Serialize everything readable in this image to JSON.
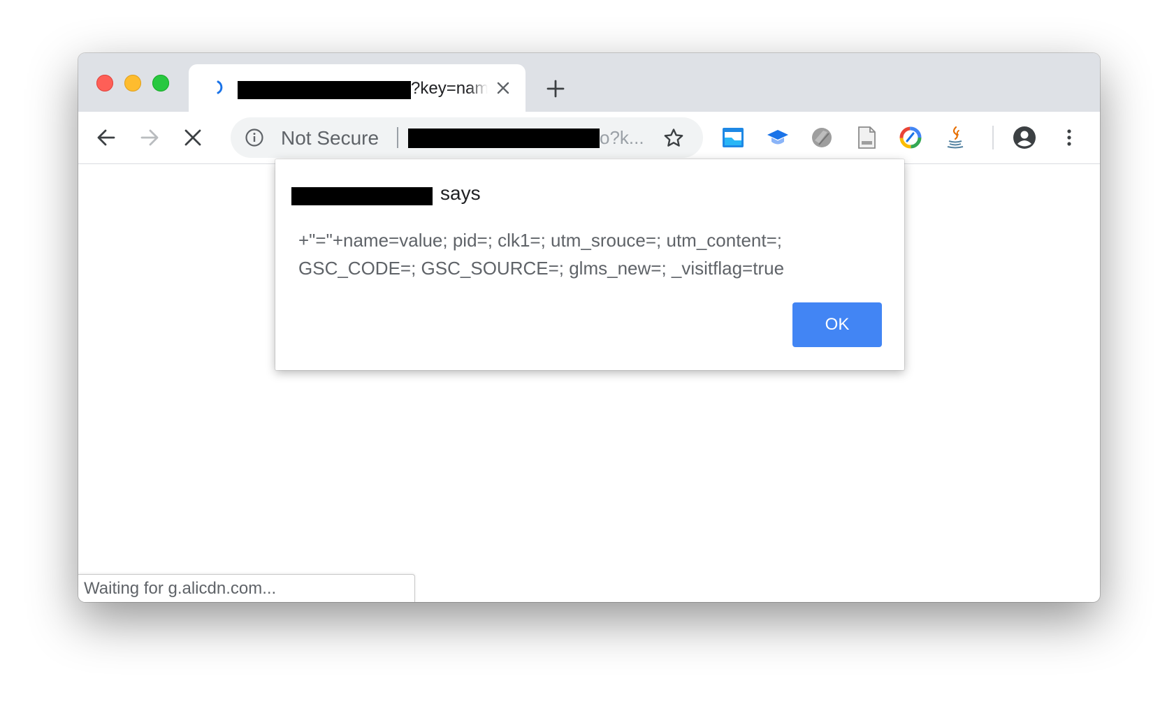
{
  "tab": {
    "title": "?key=name",
    "close_icon": "close-icon",
    "loading_icon": "tab-loading-spinner-icon"
  },
  "toolbar": {
    "back_icon": "arrow-left-icon",
    "forward_icon": "arrow-right-icon",
    "stop_icon": "close-icon",
    "new_tab_icon": "plus-icon"
  },
  "omnibox": {
    "security_label": "Not Secure",
    "url_tail": "o?k...",
    "bookmark_icon": "star-icon"
  },
  "extensions": [
    "window-extension-icon",
    "graduation-cap-icon",
    "grey-puzzle-extension-icon",
    "document-icon",
    "colorful-ring-extension-icon",
    "java-icon"
  ],
  "dialog": {
    "title_suffix": "says",
    "message": "+\"=\"+name=value; pid=; clk1=; utm_srouce=; utm_content=; GSC_CODE=; GSC_SOURCE=; glms_new=; _visitflag=true",
    "ok_label": "OK"
  },
  "status": {
    "text": "Waiting for g.alicdn.com..."
  },
  "colors": {
    "accent": "#4285f4",
    "tab_strip": "#dee1e6",
    "close_red": "#fe5f57",
    "minimize_yellow": "#febc2e",
    "zoom_green": "#28c840"
  }
}
